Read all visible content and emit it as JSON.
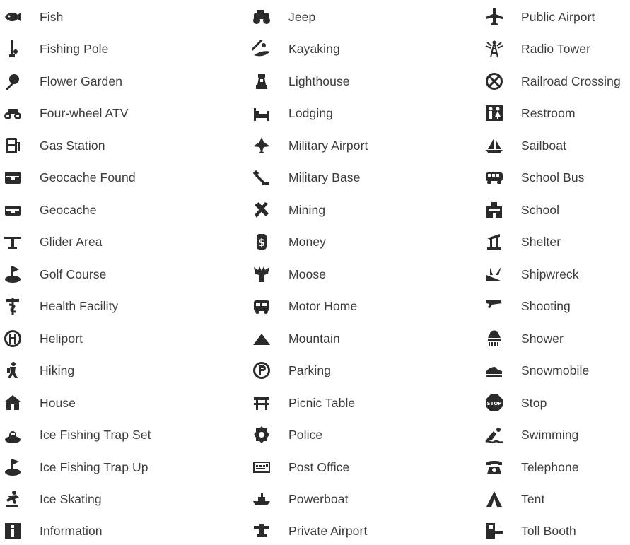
{
  "columns": [
    [
      {
        "label": "Fish",
        "icon": "fish-icon"
      },
      {
        "label": "Fishing Pole",
        "icon": "fishing-pole-icon"
      },
      {
        "label": "Flower Garden",
        "icon": "flower-garden-icon"
      },
      {
        "label": "Four-wheel ATV",
        "icon": "atv-icon"
      },
      {
        "label": "Gas Station",
        "icon": "gas-station-icon"
      },
      {
        "label": "Geocache Found",
        "icon": "geocache-found-icon"
      },
      {
        "label": "Geocache",
        "icon": "geocache-icon"
      },
      {
        "label": "Glider Area",
        "icon": "glider-icon"
      },
      {
        "label": "Golf Course",
        "icon": "golf-course-icon"
      },
      {
        "label": "Health Facility",
        "icon": "health-facility-icon"
      },
      {
        "label": "Heliport",
        "icon": "heliport-icon"
      },
      {
        "label": "Hiking",
        "icon": "hiking-icon"
      },
      {
        "label": "House",
        "icon": "house-icon"
      },
      {
        "label": "Ice Fishing Trap Set",
        "icon": "ice-fishing-trap-set-icon"
      },
      {
        "label": "Ice Fishing Trap Up",
        "icon": "ice-fishing-trap-up-icon"
      },
      {
        "label": "Ice Skating",
        "icon": "ice-skating-icon"
      },
      {
        "label": "Information",
        "icon": "information-icon"
      }
    ],
    [
      {
        "label": "Jeep",
        "icon": "jeep-icon"
      },
      {
        "label": "Kayaking",
        "icon": "kayaking-icon"
      },
      {
        "label": "Lighthouse",
        "icon": "lighthouse-icon"
      },
      {
        "label": "Lodging",
        "icon": "lodging-icon"
      },
      {
        "label": "Military Airport",
        "icon": "military-airport-icon"
      },
      {
        "label": "Military Base",
        "icon": "military-base-icon"
      },
      {
        "label": "Mining",
        "icon": "mining-icon"
      },
      {
        "label": "Money",
        "icon": "money-icon"
      },
      {
        "label": "Moose",
        "icon": "moose-icon"
      },
      {
        "label": "Motor Home",
        "icon": "motor-home-icon"
      },
      {
        "label": "Mountain",
        "icon": "mountain-icon"
      },
      {
        "label": "Parking",
        "icon": "parking-icon"
      },
      {
        "label": "Picnic Table",
        "icon": "picnic-table-icon"
      },
      {
        "label": "Police",
        "icon": "police-icon"
      },
      {
        "label": "Post Office",
        "icon": "post-office-icon"
      },
      {
        "label": "Powerboat",
        "icon": "powerboat-icon"
      },
      {
        "label": "Private Airport",
        "icon": "private-airport-icon"
      }
    ],
    [
      {
        "label": "Public Airport",
        "icon": "public-airport-icon"
      },
      {
        "label": "Radio Tower",
        "icon": "radio-tower-icon"
      },
      {
        "label": "Railroad Crossing",
        "icon": "railroad-crossing-icon"
      },
      {
        "label": "Restroom",
        "icon": "restroom-icon"
      },
      {
        "label": "Sailboat",
        "icon": "sailboat-icon"
      },
      {
        "label": "School Bus",
        "icon": "school-bus-icon"
      },
      {
        "label": "School",
        "icon": "school-icon"
      },
      {
        "label": "Shelter",
        "icon": "shelter-icon"
      },
      {
        "label": "Shipwreck",
        "icon": "shipwreck-icon"
      },
      {
        "label": "Shooting",
        "icon": "shooting-icon"
      },
      {
        "label": "Shower",
        "icon": "shower-icon"
      },
      {
        "label": "Snowmobile",
        "icon": "snowmobile-icon"
      },
      {
        "label": "Stop",
        "icon": "stop-icon"
      },
      {
        "label": "Swimming",
        "icon": "swimming-icon"
      },
      {
        "label": "Telephone",
        "icon": "telephone-icon"
      },
      {
        "label": "Tent",
        "icon": "tent-icon"
      },
      {
        "label": "Toll Booth",
        "icon": "toll-booth-icon"
      }
    ]
  ]
}
